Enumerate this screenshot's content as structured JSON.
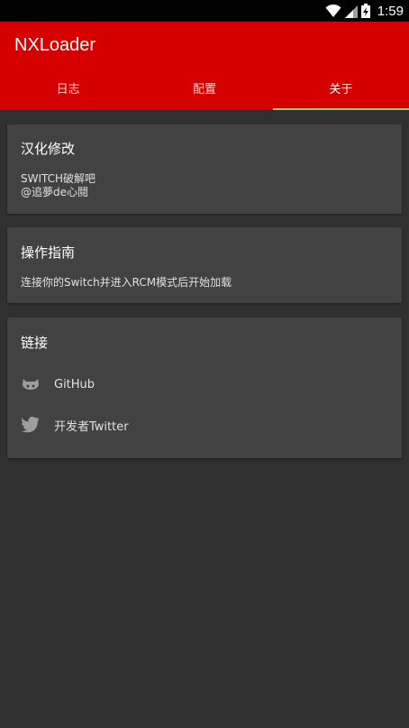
{
  "status_bar": {
    "time": "1:59"
  },
  "app": {
    "title": "NXLoader"
  },
  "tabs": [
    {
      "label": "日志"
    },
    {
      "label": "配置"
    },
    {
      "label": "关于"
    }
  ],
  "about": {
    "credits": {
      "title": "汉化修改",
      "line1": "SWITCH破解吧",
      "line2": "@追夢de心鬩"
    },
    "guide": {
      "title": "操作指南",
      "text": "连接你的Switch并进入RCM模式后开始加载"
    },
    "links": {
      "title": "链接",
      "items": [
        {
          "label": "GitHub",
          "icon": "github-icon"
        },
        {
          "label": "开发者Twitter",
          "icon": "twitter-icon"
        }
      ]
    }
  },
  "colors": {
    "app_bar": "#d50000",
    "status_bar": "#000000",
    "background": "#303030",
    "card": "#424242",
    "tab_indicator": "#9ccc65"
  }
}
